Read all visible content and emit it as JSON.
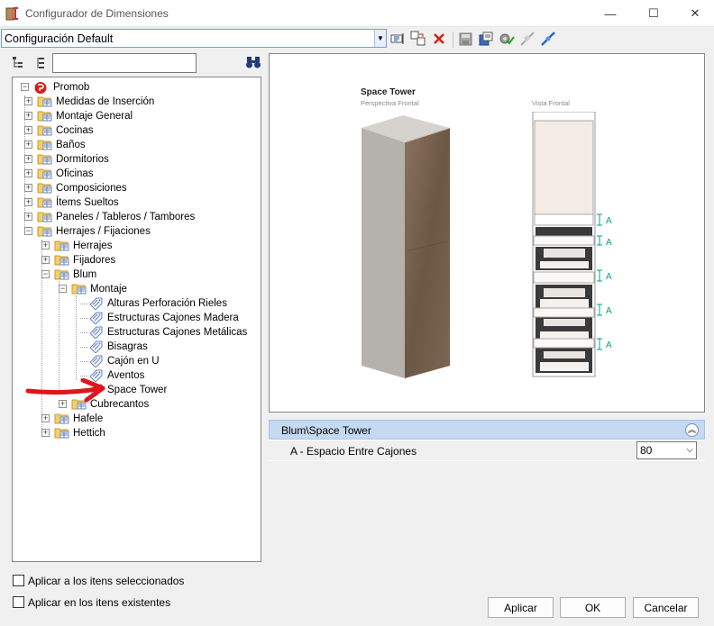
{
  "window": {
    "title": "Configurador de Dimensiones",
    "controls": {
      "minimize": "—",
      "maximize": "☐",
      "close": "✕"
    }
  },
  "toolbar": {
    "configuration": "Configuración Default",
    "icons": [
      "rename-icon",
      "copy-icon",
      "delete-icon",
      "save-icon",
      "export-icon",
      "validate-icon",
      "disconnect-icon",
      "connect-icon"
    ]
  },
  "left_toolbar": {
    "icons": [
      "tree-structure-icon",
      "list-icon",
      "binoculars-icon"
    ],
    "filter_value": ""
  },
  "tree": {
    "root": "Promob",
    "level1": [
      "Medidas de Inserción",
      "Montaje General",
      "Cocinas",
      "Baños",
      "Dormitorios",
      "Oficinas",
      "Composiciones",
      "Ítems Sueltos",
      "Paneles / Tableros / Tambores",
      "Herrajes / Fijaciones"
    ],
    "herrajes_children": [
      "Herrajes",
      "Fijadores",
      "Blum",
      "Hafele",
      "Hettich"
    ],
    "blum_children": [
      "Montaje",
      "Cubrecantos"
    ],
    "montaje_children": [
      "Alturas Perforación Rieles",
      "Estructuras Cajones Madera",
      "Estructuras Cajones Metálicas",
      "Bisagras",
      "Cajón en U",
      "Aventos",
      "Space Tower"
    ],
    "selected": "Space Tower"
  },
  "preview": {
    "title": "Space Tower",
    "subtitle": "Perspectiva Frontal",
    "front_label": "Vista Frontal",
    "dim_label": "A"
  },
  "property_grid": {
    "category": "Blum\\Space Tower",
    "property_label": "A - Espacio Entre Cajones",
    "property_value": "80"
  },
  "options": {
    "apply_selected": "Aplicar a los itens seleccionados",
    "apply_existing": "Aplicar en los itens existentes"
  },
  "buttons": {
    "apply": "Aplicar",
    "ok": "OK",
    "cancel": "Cancelar"
  },
  "colors": {
    "accent": "#c5d9f1",
    "arrow": "#e0141b",
    "dim": "#00a08a"
  }
}
